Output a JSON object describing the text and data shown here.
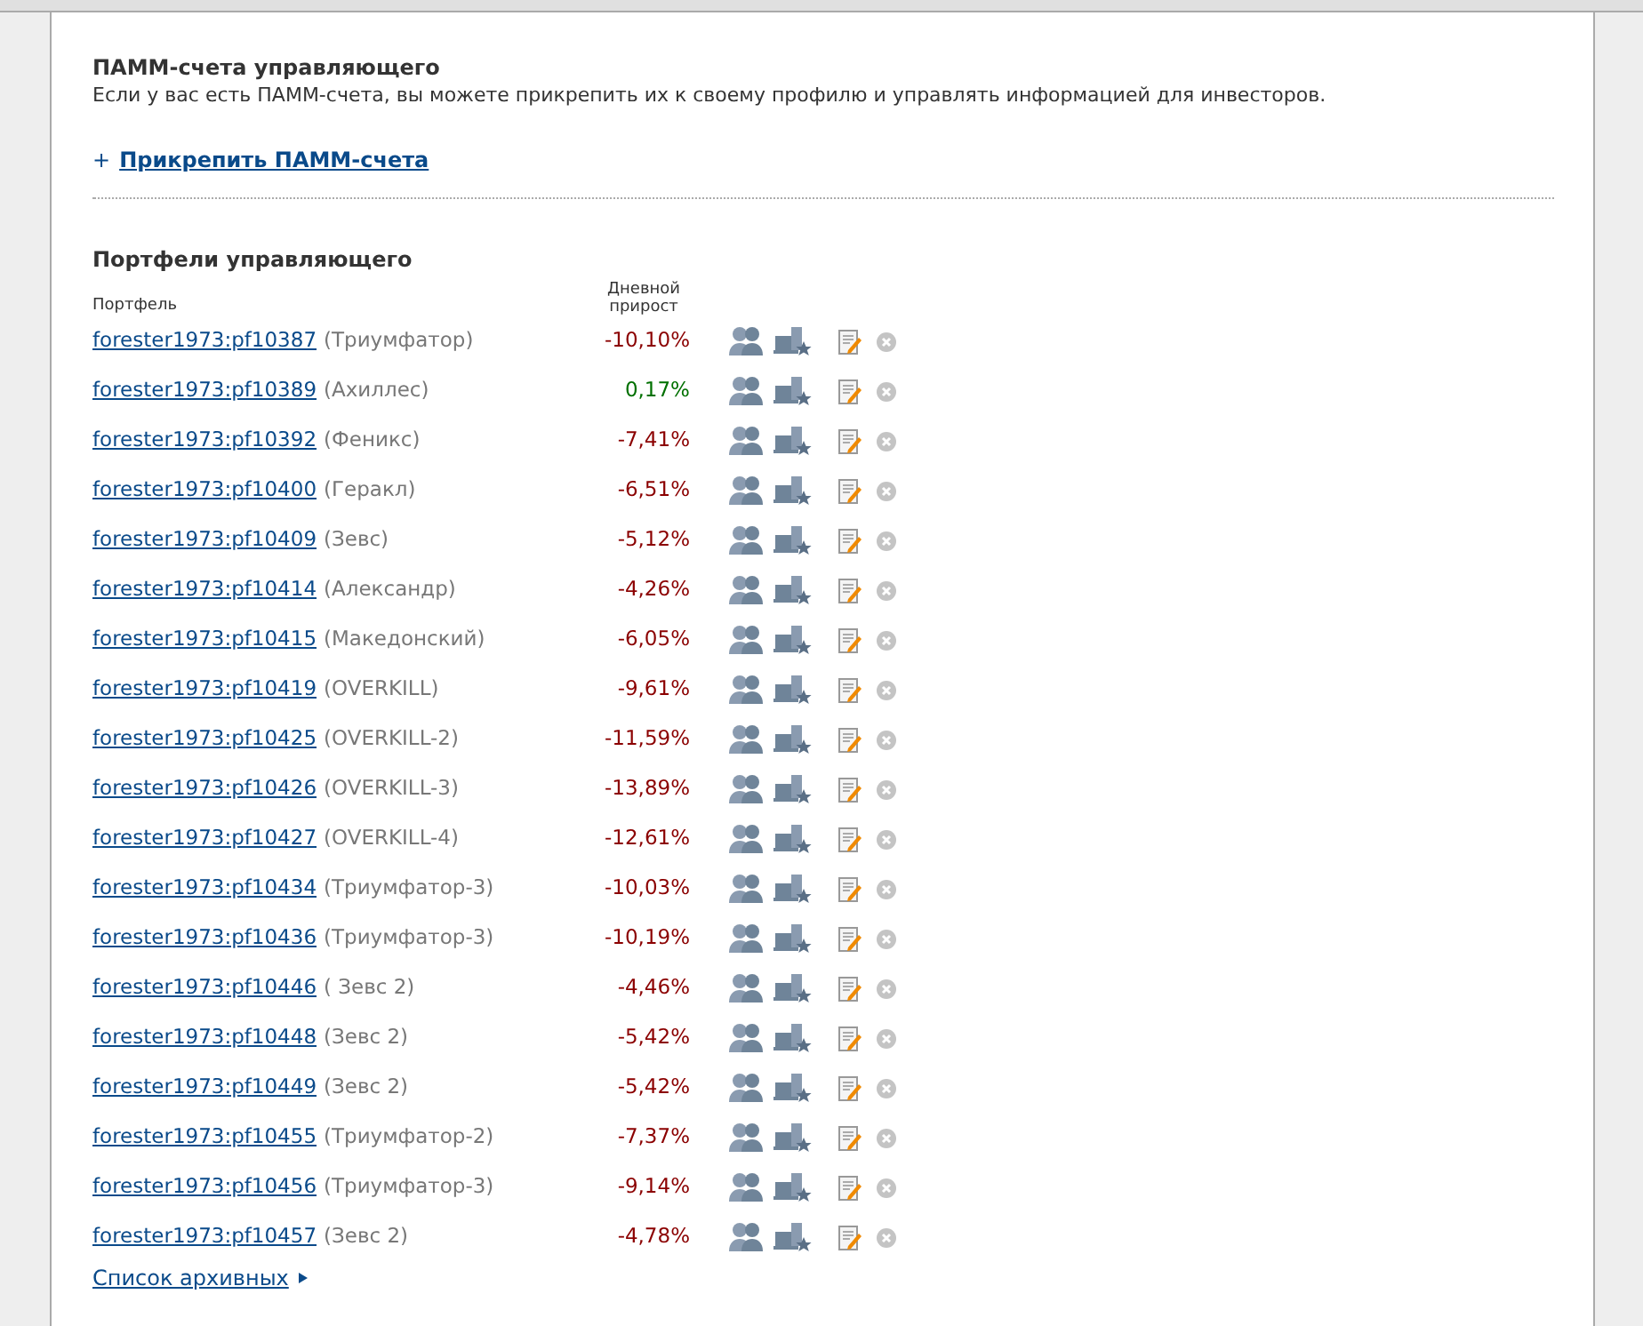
{
  "pamm": {
    "title": "ПАММ-счета управляющего",
    "description": "Если у вас есть ПАММ-счета, вы можете прикрепить их к своему профилю и управлять информацией для инвесторов.",
    "attach_prefix": "+",
    "attach_link": "Прикрепить ПАММ-счета"
  },
  "portfolios": {
    "title": "Портфели управляющего",
    "columns": [
      "Портфель",
      "Дневной прирост"
    ],
    "rows": [
      {
        "link": "forester1973:pf10387",
        "name": "(Триумфатор)",
        "change": "-10,10%",
        "color": "#8b0000"
      },
      {
        "link": "forester1973:pf10389",
        "name": "(Ахиллес)",
        "change": "0,17%",
        "color": "#007000"
      },
      {
        "link": "forester1973:pf10392",
        "name": "(Феникс)",
        "change": "-7,41%",
        "color": "#8b0000"
      },
      {
        "link": "forester1973:pf10400",
        "name": "(Геракл)",
        "change": "-6,51%",
        "color": "#8b0000"
      },
      {
        "link": "forester1973:pf10409",
        "name": "(Зевс)",
        "change": "-5,12%",
        "color": "#8b0000"
      },
      {
        "link": "forester1973:pf10414",
        "name": "(Александр)",
        "change": "-4,26%",
        "color": "#8b0000"
      },
      {
        "link": "forester1973:pf10415",
        "name": "(Македонский)",
        "change": "-6,05%",
        "color": "#8b0000"
      },
      {
        "link": "forester1973:pf10419",
        "name": "(OVERKILL)",
        "change": "-9,61%",
        "color": "#8b0000"
      },
      {
        "link": "forester1973:pf10425",
        "name": "(OVERKILL-2)",
        "change": "-11,59%",
        "color": "#8b0000"
      },
      {
        "link": "forester1973:pf10426",
        "name": "(OVERKILL-3)",
        "change": "-13,89%",
        "color": "#8b0000"
      },
      {
        "link": "forester1973:pf10427",
        "name": "(OVERKILL-4)",
        "change": "-12,61%",
        "color": "#8b0000"
      },
      {
        "link": "forester1973:pf10434",
        "name": "(Триумфатор-3)",
        "change": "-10,03%",
        "color": "#8b0000"
      },
      {
        "link": "forester1973:pf10436",
        "name": "(Триумфатор-3)",
        "change": "-10,19%",
        "color": "#8b0000"
      },
      {
        "link": "forester1973:pf10446",
        "name": "( Зевс 2)",
        "change": "-4,46%",
        "color": "#8b0000"
      },
      {
        "link": "forester1973:pf10448",
        "name": "(Зевс 2)",
        "change": "-5,42%",
        "color": "#8b0000"
      },
      {
        "link": "forester1973:pf10449",
        "name": "(Зевс 2)",
        "change": "-5,42%",
        "color": "#8b0000"
      },
      {
        "link": "forester1973:pf10455",
        "name": "(Триумфатор-2)",
        "change": "-7,37%",
        "color": "#8b0000"
      },
      {
        "link": "forester1973:pf10456",
        "name": "(Триумфатор-3)",
        "change": "-9,14%",
        "color": "#8b0000"
      },
      {
        "link": "forester1973:pf10457",
        "name": "(Зевс 2)",
        "change": "-4,78%",
        "color": "#8b0000"
      }
    ],
    "archive_link": "Список архивных"
  }
}
